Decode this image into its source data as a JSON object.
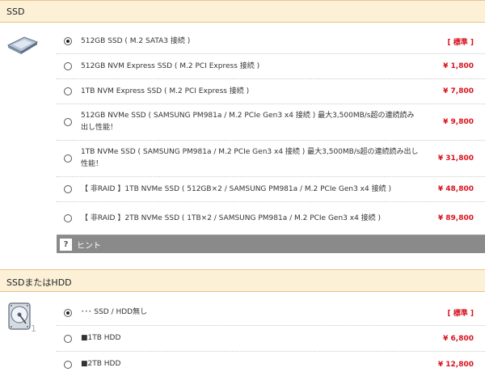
{
  "sections": {
    "ssd": {
      "title": "SSD"
    },
    "hdd": {
      "title": "SSDまたはHDD",
      "icon_number": "1"
    }
  },
  "ssd_options": [
    {
      "label": "512GB SSD ( M.2 SATA3 接続 )",
      "price": "[ 標準 ]",
      "selected": true
    },
    {
      "label": "512GB NVM Express SSD ( M.2 PCI Express 接続 )",
      "price": "¥ 1,800",
      "selected": false
    },
    {
      "label": "1TB NVM Express SSD ( M.2 PCI Express 接続 )",
      "price": "¥ 7,800",
      "selected": false
    },
    {
      "label": "512GB NVMe SSD ( SAMSUNG PM981a / M.2 PCIe Gen3 x4 接続 ) 最大3,500MB/s超の連続読み出し性能！",
      "price": "¥ 9,800",
      "selected": false
    },
    {
      "label": "1TB NVMe SSD ( SAMSUNG PM981a / M.2 PCIe Gen3 x4 接続 ) 最大3,500MB/s超の連続読み出し性能！",
      "price": "¥ 31,800",
      "selected": false
    },
    {
      "label": "【 非RAID 】1TB NVMe SSD ( 512GB×2 / SAMSUNG PM981a / M.2 PCIe Gen3 x4 接続 )",
      "price": "¥ 48,800",
      "selected": false
    },
    {
      "label": "【 非RAID 】2TB NVMe SSD ( 1TB×2 / SAMSUNG PM981a / M.2 PCIe Gen3 x4 接続 )",
      "price": "¥ 89,800",
      "selected": false
    }
  ],
  "hint": {
    "icon": "?",
    "label": "ヒント"
  },
  "hdd_options": [
    {
      "label": "･･･ SSD / HDD無し",
      "price": "[ 標準 ]",
      "selected": true
    },
    {
      "label": "■1TB HDD",
      "price": "¥ 6,800",
      "selected": false
    },
    {
      "label": "■2TB HDD",
      "price": "¥ 12,800",
      "selected": false
    }
  ],
  "colors": {
    "header_bg": "#fcf0d7",
    "price": "#d9111b",
    "hint_bg": "#8a8a8a"
  }
}
